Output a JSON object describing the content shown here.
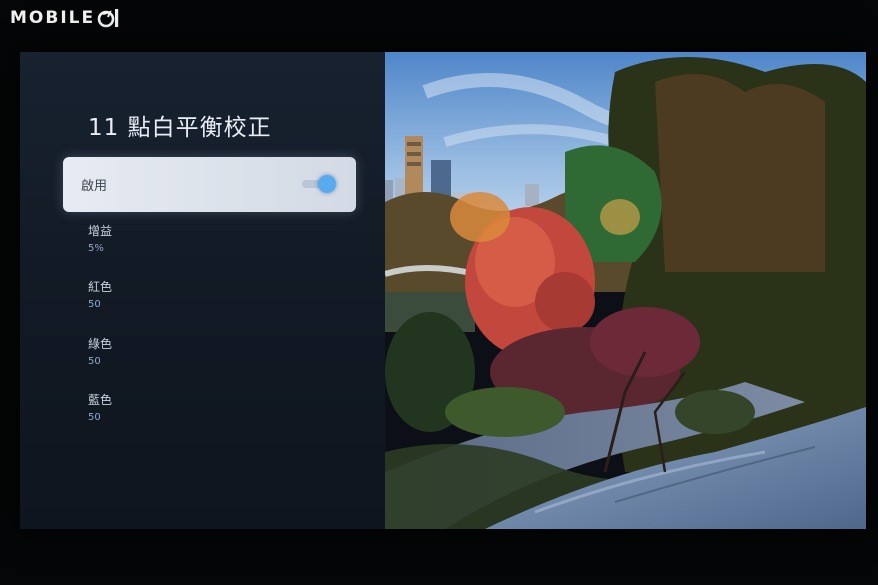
{
  "watermark": {
    "text": "MOBILE"
  },
  "settings_panel": {
    "title": "11 點白平衡校正",
    "enable_toggle": {
      "label": "啟用",
      "state": "on",
      "accent_color": "#5aaaf0"
    },
    "items": [
      {
        "label": "增益",
        "value": "5%"
      },
      {
        "label": "紅色",
        "value": "50"
      },
      {
        "label": "綠色",
        "value": "50"
      },
      {
        "label": "藍色",
        "value": "50"
      }
    ]
  }
}
